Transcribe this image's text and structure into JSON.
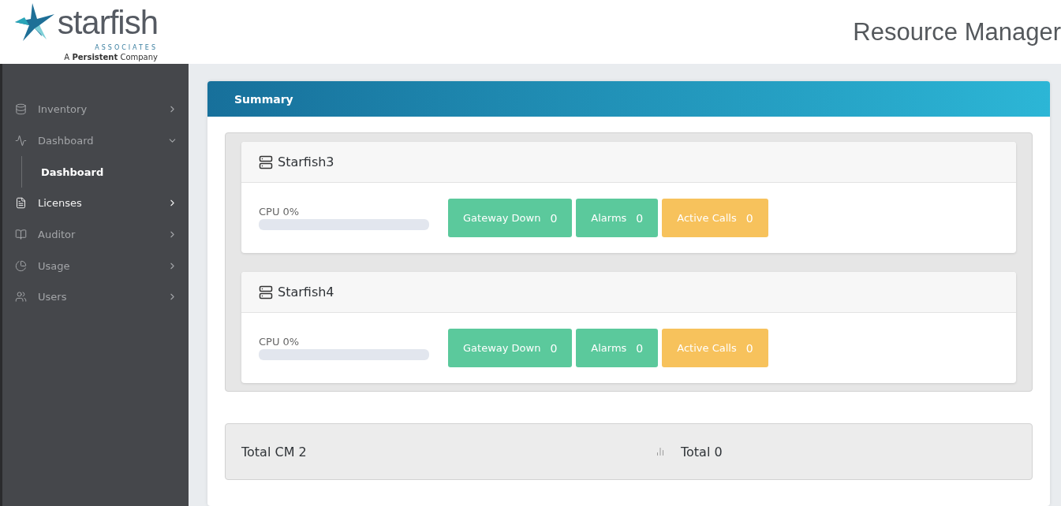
{
  "logo": {
    "name": "starfish",
    "subtitle": "ASSOCIATES",
    "tagline": "A **Persistent** Company"
  },
  "header": {
    "title": "Resource Manager"
  },
  "sidebar": {
    "items": [
      {
        "label": "Inventory",
        "expanded": false,
        "highlighted": false
      },
      {
        "label": "Dashboard",
        "expanded": true,
        "highlighted": false,
        "children": [
          {
            "label": "Dashboard",
            "selected": true
          }
        ]
      },
      {
        "label": "Licenses",
        "expanded": false,
        "highlighted": true
      },
      {
        "label": "Auditor",
        "expanded": false,
        "highlighted": false
      },
      {
        "label": "Usage",
        "expanded": false,
        "highlighted": false
      },
      {
        "label": "Users",
        "expanded": false,
        "highlighted": false
      }
    ]
  },
  "summary": {
    "title": "Summary",
    "servers": [
      {
        "name": "Starfish3",
        "cpu_label": "CPU 0%",
        "level": 0,
        "stats": [
          {
            "label": "Gateway Down",
            "value": "0",
            "color": "#5bc99c"
          },
          {
            "label": "Alarms",
            "value": "0",
            "color": "#5bc99c"
          },
          {
            "label": "Active Calls",
            "value": "0",
            "color": "#f7c25c"
          }
        ]
      },
      {
        "name": "Starfish4",
        "cpu_label": "CPU 0%",
        "level": 0,
        "stats": [
          {
            "label": "Gateway Down",
            "value": "0",
            "color": "#5bc99c"
          },
          {
            "label": "Alarms",
            "value": "0",
            "color": "#5bc99c"
          },
          {
            "label": "Active Calls",
            "value": "0",
            "color": "#f7c25c"
          }
        ]
      }
    ],
    "totals": {
      "cm": "Total CM 2",
      "total": "Total 0"
    }
  }
}
